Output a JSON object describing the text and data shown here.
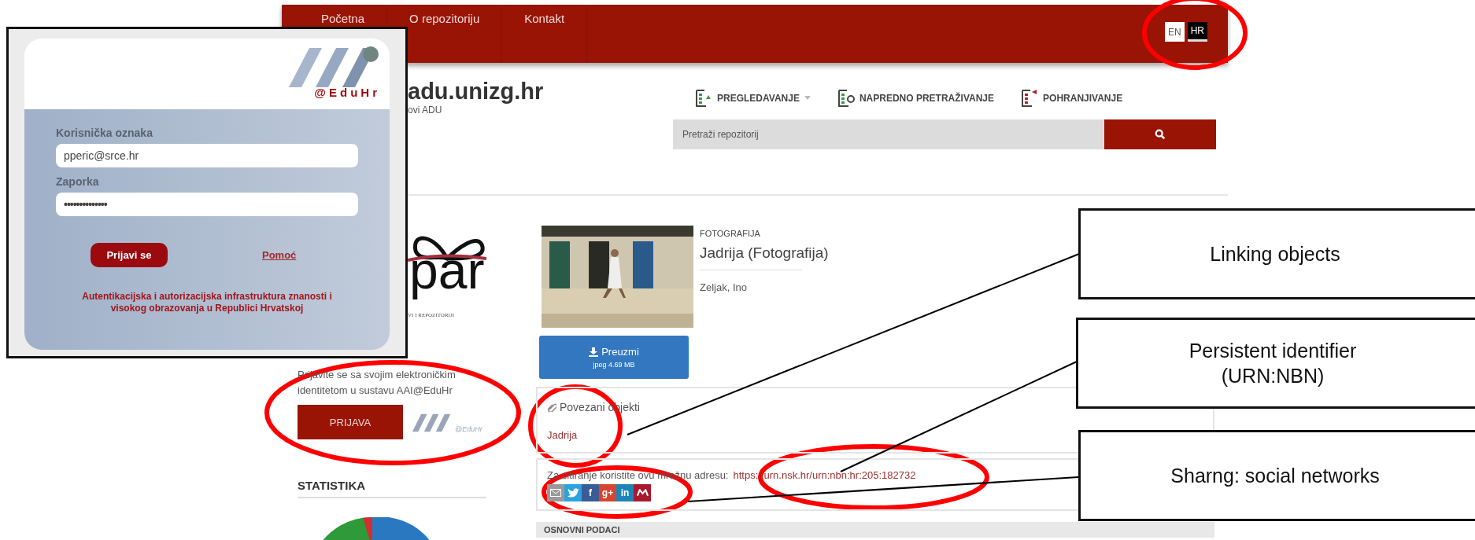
{
  "login_popup": {
    "logo_text": "@EduHr",
    "username_label": "Korisnička oznaka",
    "username_value": "pperic@srce.hr",
    "password_label": "Zaporka",
    "password_value": "••••••••••••••",
    "submit_button": "Prijavi se",
    "help_link": "Pomoć",
    "footer": "Autentikacijska i autorizacijska infrastruktura znanosti i visokog obrazovanja u Republici Hrvatskoj"
  },
  "page": {
    "nav": [
      {
        "label": "Početna"
      },
      {
        "label": "O repozitoriju"
      },
      {
        "label": "Kontakt"
      }
    ],
    "languages": [
      {
        "label": "EN",
        "selected": false
      },
      {
        "label": "HR",
        "selected": true
      }
    ],
    "site_title": "adu.unizg.hr",
    "site_subtitle": "ovi ADU",
    "actions": [
      {
        "label": "PREGLEDAVANJE",
        "kind": "browse",
        "dropdown": true
      },
      {
        "label": "NAPREDNO PRETRAŽIVANJE",
        "kind": "search",
        "dropdown": false
      },
      {
        "label": "POHRANJIVANJE",
        "kind": "deposit",
        "dropdown": false
      }
    ],
    "search": {
      "placeholder": "Pretraži repozitorij"
    },
    "sidebar": {
      "logo_text": "par",
      "logo_caption": "VI I REPOZITORIJI",
      "login_text": "Prijavite se sa svojim elektroničkim identitetom u sustavu AAI@EduHr",
      "login_button": "PRIJAVA",
      "aai_caption": "@EduHr",
      "stats_title": "STATISTIKA"
    },
    "item": {
      "type": "FOTOGRAFIJA",
      "title": "Jadrija (Fotografija)",
      "author": "Zeljak, Ino",
      "download_label": "Preuzmi",
      "download_info": "jpeg 4.69 MB"
    },
    "linked_objects": {
      "title": "Povezani objekti",
      "items": [
        "Jadrija"
      ]
    },
    "citation": {
      "text": "Za citiranje koristite ovu mrežnu adresu:",
      "url": "https://urn.nsk.hr/urn:nbn:hr:205:182732"
    },
    "share": [
      {
        "kind": "email",
        "color": "#9a9a9a"
      },
      {
        "kind": "twitter",
        "color": "#2aa3de"
      },
      {
        "kind": "facebook",
        "color": "#3b5b98",
        "glyph": "f"
      },
      {
        "kind": "googleplus",
        "color": "#d7442f",
        "glyph": "g+"
      },
      {
        "kind": "linkedin",
        "color": "#1d84b8",
        "glyph": "in"
      },
      {
        "kind": "mendeley",
        "color": "#a8192e"
      }
    ],
    "section_title": "OSNOVNI PODACI"
  },
  "callouts": [
    "Linking objects",
    "Persistent identifier\n(URN:NBN)",
    "Sharng: social networks"
  ]
}
